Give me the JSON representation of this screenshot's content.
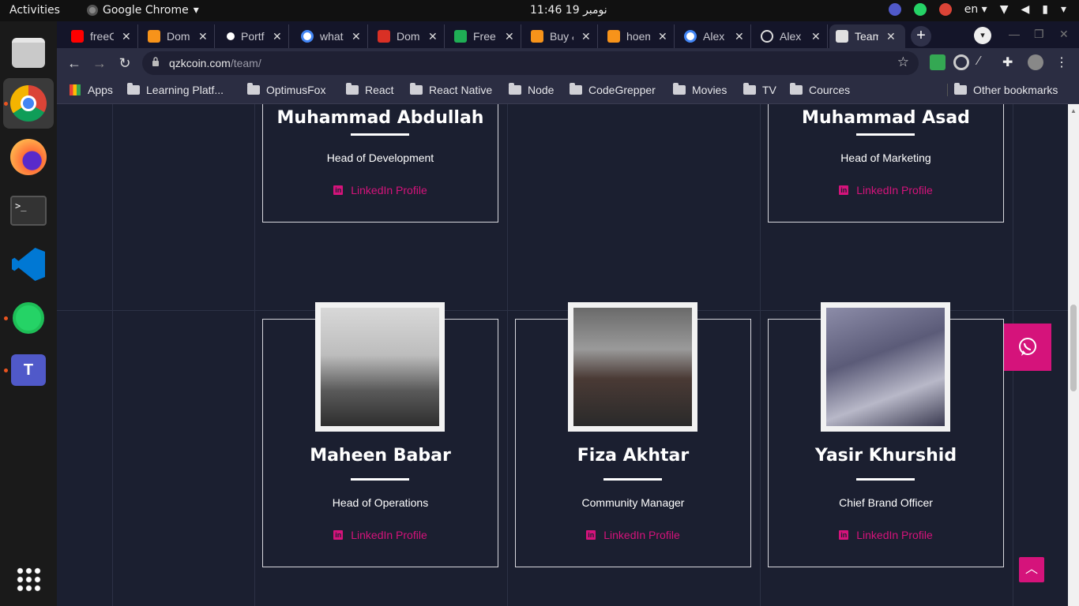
{
  "system": {
    "activities": "Activities",
    "app_name": "Google Chrome",
    "clock": "11:46  19 نومبر",
    "lang": "en"
  },
  "browser": {
    "tabs": [
      {
        "label": "freeC",
        "icon": "youtube-icon",
        "color": "#ff0000"
      },
      {
        "label": "Dom",
        "icon": "coinmarket-icon",
        "color": "#f7931a"
      },
      {
        "label": "Portf",
        "icon": "portfolio-icon",
        "color": "#ffffff"
      },
      {
        "label": "what",
        "icon": "google-icon",
        "color": "#4285f4"
      },
      {
        "label": "Dom",
        "icon": "domain-icon",
        "color": "#d93025"
      },
      {
        "label": "Free",
        "icon": "com-icon",
        "color": "#1fae55"
      },
      {
        "label": "Buy &",
        "icon": "coinmarket-icon",
        "color": "#f7931a"
      },
      {
        "label": "hoem",
        "icon": "coinmarket-icon",
        "color": "#f7931a"
      },
      {
        "label": "Alex",
        "icon": "google-icon",
        "color": "#4285f4"
      },
      {
        "label": "Alex",
        "icon": "at-icon",
        "color": "#dddddd"
      },
      {
        "label": "Team",
        "icon": "qzk-icon",
        "color": "#e0e0e0"
      }
    ],
    "url_host": "qzkcoin.com",
    "url_path": "/team/",
    "bookmarks": [
      {
        "label": "Apps"
      },
      {
        "label": "Learning Platf..."
      },
      {
        "label": "OptimusFox"
      },
      {
        "label": "React"
      },
      {
        "label": "React Native"
      },
      {
        "label": "Node"
      },
      {
        "label": "CodeGrepper"
      },
      {
        "label": "Movies"
      },
      {
        "label": "TV"
      },
      {
        "label": "Cources"
      },
      {
        "label": "Other bookmarks"
      }
    ]
  },
  "team": {
    "link_label": "LinkedIn Profile",
    "members": [
      {
        "name": "Muhammad Abdullah",
        "role": "Head of Development"
      },
      {
        "name": "Muhammad Asad",
        "role": "Head of Marketing"
      },
      {
        "name": "Maheen Babar",
        "role": "Head of Operations"
      },
      {
        "name": "Fiza Akhtar",
        "role": "Community Manager"
      },
      {
        "name": "Yasir Khurshid",
        "role": "Chief Brand Officer"
      }
    ]
  },
  "colors": {
    "accent": "#d5137b",
    "background": "#1b1f30"
  }
}
